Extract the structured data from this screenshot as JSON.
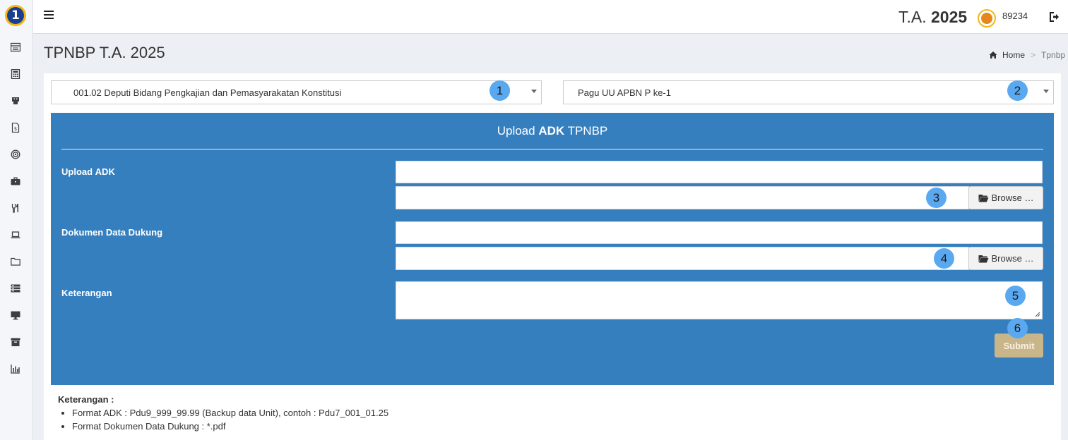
{
  "header": {
    "ta_prefix": "T.A.",
    "ta_year": "2025",
    "user_id": "89234"
  },
  "page": {
    "title": "TPNBP T.A. 2025"
  },
  "breadcrumb": {
    "home": "Home",
    "current": "Tpnbp"
  },
  "filters": {
    "unit_select": "001.02 Deputi Bidang Pengkajian dan Pemasyarakatan Konstitusi",
    "pagu_select": "Pagu UU APBN P ke-1"
  },
  "form": {
    "title_prefix": "Upload ",
    "title_bold": "ADK",
    "title_suffix": " TPNBP",
    "upload_label_prefix": "Upload ",
    "upload_label_bold": "ADK",
    "dokumen_label": "Dokumen Data Dukung",
    "keterangan_label": "Keterangan",
    "browse_label": "Browse …",
    "submit_label": "Submit"
  },
  "badges": [
    "1",
    "2",
    "3",
    "4",
    "5",
    "6"
  ],
  "notes": {
    "title": "Keterangan :",
    "items": [
      "Format ADK : Pdu9_999_99.99 (Backup data Unit), contoh : Pdu7_001_01.25",
      "Format Dokumen Data Dukung : *.pdf"
    ]
  },
  "sidebar_icons": [
    "list-icon",
    "calculator-icon",
    "building-icon",
    "document-money-icon",
    "target-icon",
    "briefcase-icon",
    "utensils-icon",
    "laptop-icon",
    "folder-icon",
    "server-icon",
    "monitor-icon",
    "archive-icon",
    "bar-chart-icon"
  ],
  "colors": {
    "panel_blue": "#367fbf",
    "badge_blue": "#5aa9f0",
    "submit_tan": "#c9b58a",
    "logo_gold": "#f2b619",
    "logo_navy": "#1b3f8f"
  }
}
